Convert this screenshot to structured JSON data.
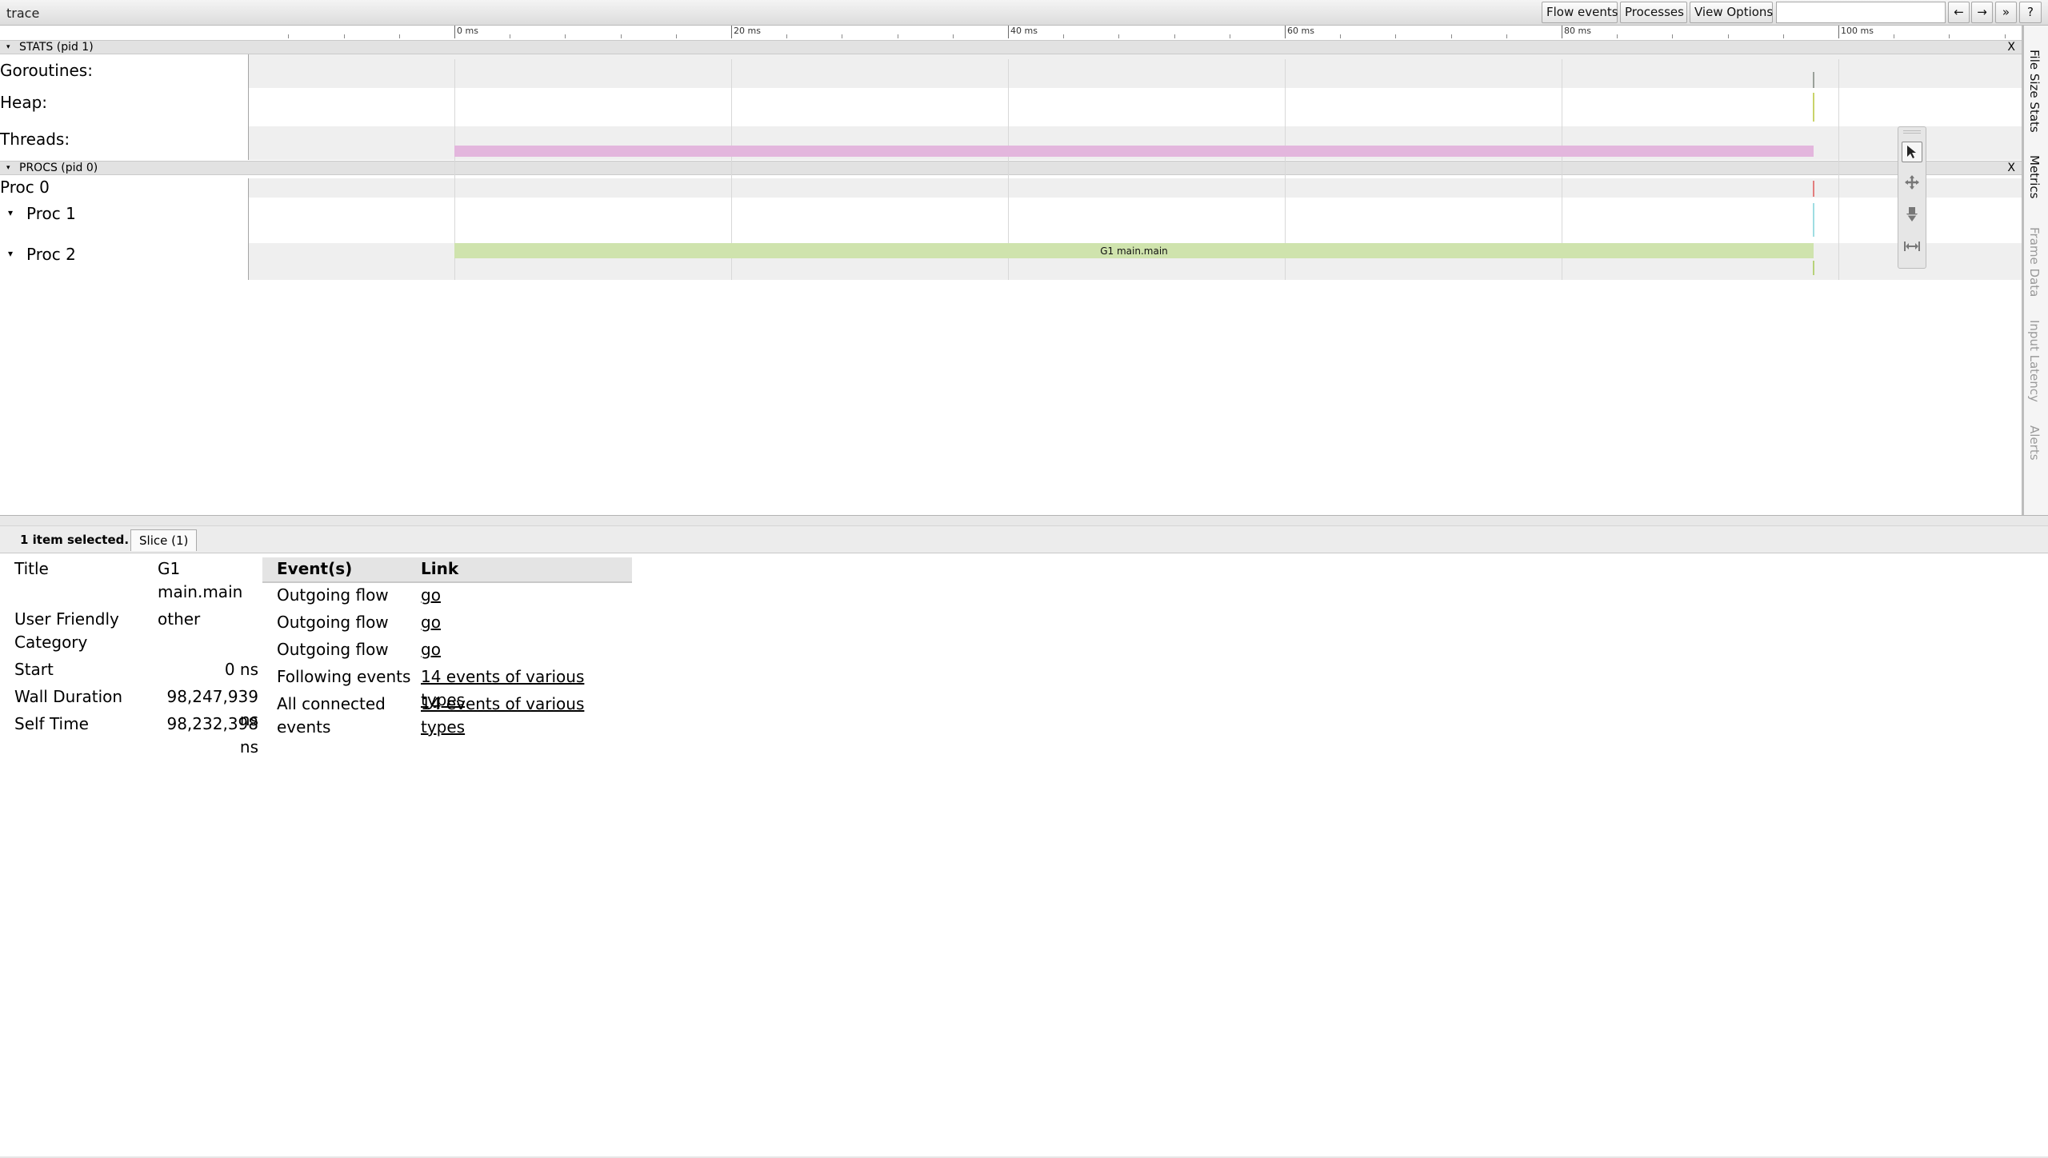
{
  "app": {
    "title": "trace"
  },
  "toolbar": {
    "flow_events": "Flow events",
    "processes": "Processes",
    "view_options": "View Options",
    "search_value": "",
    "prev_arrow": "←",
    "next_arrow": "→",
    "more": "»",
    "help": "?"
  },
  "ruler": {
    "labels": [
      "0 ms",
      "20 ms",
      "40 ms",
      "60 ms",
      "80 ms",
      "100 ms"
    ]
  },
  "stats": {
    "header": "STATS (pid 1)",
    "collapse_glyph": "▾",
    "close": "X",
    "tracks": [
      "Goroutines:",
      "Heap:",
      "Threads:"
    ]
  },
  "procs": {
    "header": "PROCS (pid 0)",
    "collapse_glyph": "▾",
    "close": "X",
    "proc0": "Proc 0",
    "proc1": "Proc 1",
    "proc2": "Proc 2",
    "expand_glyph": "▾",
    "slice_title": "G1 main.main"
  },
  "colors": {
    "threads_slice": "#e3b6dd",
    "main_slice": "#cfe3ad"
  },
  "side_tabs": [
    "File Size Stats",
    "Metrics",
    "Frame Data",
    "Input Latency",
    "Alerts"
  ],
  "analysis": {
    "selected": "1 item selected.",
    "tab": "Slice (1)",
    "props": {
      "title_label": "Title",
      "title_value_1": "G1",
      "title_value_2": "main.main",
      "category_label_1": "User Friendly",
      "category_label_2": "Category",
      "category_value": "other",
      "start_label": "Start",
      "start_value": "0 ns",
      "wall_label": "Wall Duration",
      "wall_value": "98,247,939 ns",
      "self_label": "Self Time",
      "self_value": "98,232,398 ns"
    },
    "flow": {
      "col_events": "Event(s)",
      "col_link": "Link",
      "rows": [
        {
          "event": "Outgoing flow",
          "link": "go"
        },
        {
          "event": "Outgoing flow",
          "link": "go"
        },
        {
          "event": "Outgoing flow",
          "link": "go"
        },
        {
          "event": "Following events",
          "link": "14 events of various types"
        },
        {
          "event": "All connected",
          "event2": "events",
          "link": "14 events of various types"
        }
      ]
    }
  }
}
